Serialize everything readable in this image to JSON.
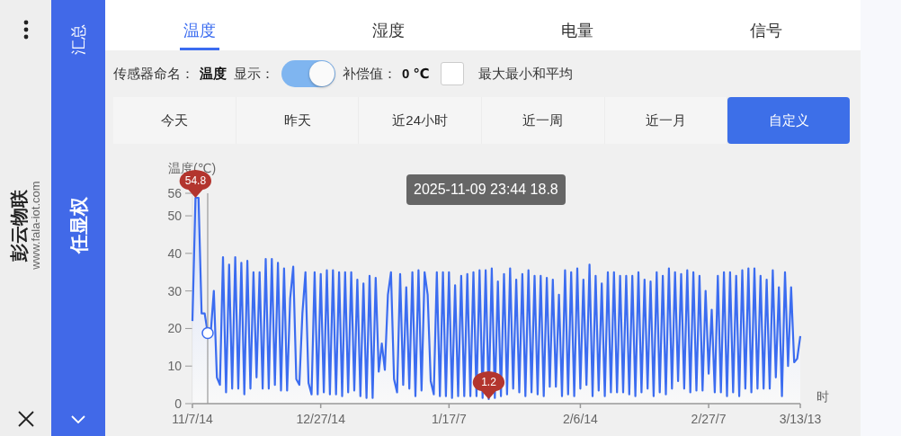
{
  "sidebar": {
    "brand": "彭云物联",
    "url": "www.fala-iot.com"
  },
  "rail": {
    "summary_label": "汇总",
    "user_name": "任显权"
  },
  "tabs": [
    {
      "label": "温度",
      "selected": true
    },
    {
      "label": "湿度",
      "selected": false
    },
    {
      "label": "电量",
      "selected": false
    },
    {
      "label": "信号",
      "selected": false
    }
  ],
  "settings": {
    "name_label": "传感器命名：",
    "name_value": "温度",
    "show_label": "显示：",
    "show_on": true,
    "offset_label": "补偿值：",
    "offset_value": "0 ℃",
    "stats_checked": false,
    "stats_label": "最大最小和平均"
  },
  "ranges": [
    {
      "label": "今天",
      "selected": false
    },
    {
      "label": "昨天",
      "selected": false
    },
    {
      "label": "近24小时",
      "selected": false
    },
    {
      "label": "近一周",
      "selected": false
    },
    {
      "label": "近一月",
      "selected": false
    },
    {
      "label": "自定义",
      "selected": true
    }
  ],
  "chart": {
    "tooltip": "2025-11-09 23:44 18.8",
    "chart_data": {
      "type": "area",
      "ylabel": "温度(℃)",
      "xlabel": "时",
      "ylim": [
        0,
        56
      ],
      "categories": [
        "11/7/14",
        null,
        null,
        null,
        null,
        null,
        null,
        null,
        null,
        null,
        null,
        null,
        null,
        null,
        null,
        null,
        null,
        null,
        null,
        null,
        null,
        null,
        null,
        null,
        null,
        null,
        null,
        null,
        null,
        null,
        null,
        null,
        null,
        null,
        null,
        null,
        null,
        null,
        null,
        null,
        null,
        null,
        "12/27/14",
        null,
        null,
        null,
        null,
        null,
        null,
        null,
        null,
        null,
        null,
        null,
        null,
        null,
        null,
        null,
        null,
        null,
        null,
        null,
        null,
        null,
        null,
        null,
        null,
        null,
        null,
        null,
        null,
        null,
        null,
        null,
        null,
        null,
        null,
        null,
        null,
        null,
        null,
        null,
        null,
        null,
        "1/17/7",
        null,
        null,
        null,
        null,
        null,
        null,
        null,
        null,
        null,
        null,
        null,
        null,
        null,
        null,
        null,
        null,
        null,
        null,
        null,
        null,
        null,
        null,
        null,
        null,
        null,
        null,
        null,
        null,
        null,
        null,
        null,
        null,
        null,
        null,
        null,
        null,
        null,
        null,
        null,
        null,
        null,
        null,
        "2/6/14",
        null,
        null,
        null,
        null,
        null,
        null,
        null,
        null,
        null,
        null,
        null,
        null,
        null,
        null,
        null,
        null,
        null,
        null,
        null,
        null,
        null,
        null,
        null,
        null,
        null,
        null,
        null,
        null,
        null,
        null,
        null,
        null,
        null,
        null,
        null,
        null,
        null,
        null,
        null,
        null,
        null,
        "2/27/7",
        null,
        null,
        null,
        null,
        null,
        null,
        null,
        null,
        null,
        null,
        null,
        null,
        null,
        null,
        null,
        null,
        null,
        null,
        null,
        null,
        null,
        null,
        null,
        null,
        null,
        null,
        null,
        null,
        null,
        "3/13/13"
      ],
      "yticks": [
        0,
        10,
        20,
        30,
        40,
        50,
        56
      ],
      "values": [
        22,
        54.8,
        54.8,
        24,
        24,
        18.8,
        19,
        30,
        7,
        5,
        39,
        3,
        37,
        4,
        39,
        4,
        37.5,
        2.5,
        38,
        4,
        35,
        7,
        35,
        4,
        38.5,
        4,
        38.5,
        5,
        37.5,
        3.5,
        36,
        3.5,
        28,
        36.5,
        6.5,
        5,
        24,
        35,
        5.5,
        2.5,
        35,
        2.5,
        34.5,
        3,
        35.5,
        2.5,
        35.5,
        2.5,
        35,
        2,
        35,
        3,
        35,
        3.5,
        33,
        2,
        32,
        1.5,
        34,
        1.5,
        33.5,
        8.5,
        16,
        9,
        29,
        35,
        6.5,
        3,
        34.5,
        5,
        31,
        4,
        35,
        2,
        35.5,
        3.5,
        35,
        29,
        6,
        2.5,
        35,
        2,
        35,
        2,
        35,
        1.5,
        31.5,
        2,
        34,
        2,
        34.5,
        2,
        35,
        2,
        35.5,
        1.5,
        35.5,
        1.2,
        36,
        1.5,
        32.5,
        2,
        34.5,
        2.5,
        36,
        4,
        33,
        3,
        34.5,
        2,
        35.5,
        3,
        34,
        2.5,
        34,
        2,
        33.5,
        4.5,
        33,
        4.5,
        29,
        2,
        35.5,
        2.5,
        35,
        2,
        36,
        4,
        33,
        5,
        37,
        2,
        34,
        3.5,
        32,
        2,
        35,
        3,
        35,
        3,
        34,
        3,
        34,
        2.5,
        34,
        2,
        35,
        3,
        33,
        4,
        32.5,
        2,
        35,
        3,
        34,
        2.5,
        36,
        4,
        35,
        6,
        34.5,
        4,
        35.5,
        3,
        35,
        3.5,
        34,
        3.5,
        30,
        8,
        25,
        3,
        34,
        3,
        35,
        2,
        35,
        3,
        34,
        2,
        35.5,
        4,
        36,
        3,
        36,
        4,
        34,
        4,
        33,
        4,
        35.5,
        7,
        31,
        2,
        35,
        10,
        31,
        11,
        12,
        18
      ],
      "annotations": [
        {
          "y": 54.8,
          "text": "54.8"
        },
        {
          "y": 1.2,
          "text": "1.2"
        }
      ]
    }
  }
}
